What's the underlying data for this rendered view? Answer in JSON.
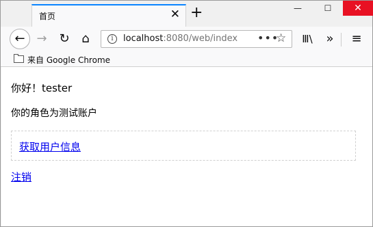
{
  "tab": {
    "title": "首页",
    "close_label": "✕",
    "newtab_label": "+"
  },
  "window_controls": {
    "min": "—",
    "max": "☐",
    "close": "✕"
  },
  "toolbar": {
    "url_host": "localhost",
    "url_rest": ":8080/web/index",
    "info_glyph": "i",
    "dots": "•••",
    "star": "☆"
  },
  "icons": {
    "back": "←",
    "forward": "→",
    "reload": "↻",
    "home": "⌂",
    "library": "Ⅲ\\",
    "overflow": "»",
    "menu": "≡"
  },
  "bookmarks": {
    "items": [
      {
        "label": "来自 Google Chrome"
      }
    ]
  },
  "page": {
    "greeting": "你好！tester",
    "role_text": "你的角色为测试账户",
    "get_user_info_link": "获取用户信息",
    "logout_link": "注销"
  }
}
